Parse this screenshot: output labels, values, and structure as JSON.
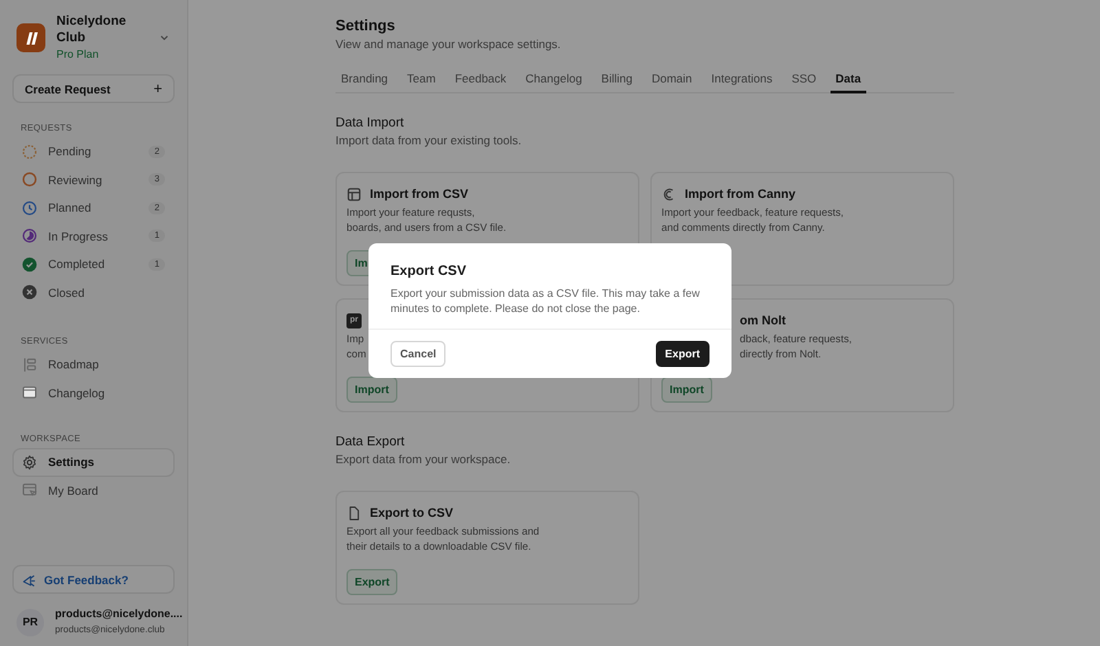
{
  "workspace": {
    "name": "Nicelydone Club",
    "plan": "Pro Plan"
  },
  "create_button": {
    "label": "Create Request",
    "icon": "+"
  },
  "sidebar": {
    "sections": [
      {
        "title": "REQUESTS",
        "items": [
          {
            "label": "Pending",
            "count": "2",
            "kind": "dashed-circle",
            "color": "#8b6136",
            "selected": false
          },
          {
            "label": "Reviewing",
            "count": "3",
            "kind": "circle",
            "color": "#894923",
            "selected": false
          },
          {
            "label": "Planned",
            "count": "2",
            "kind": "clock",
            "color": "#234a86",
            "selected": false
          },
          {
            "label": "In Progress",
            "count": "1",
            "kind": "half-circle",
            "color": "#532a79",
            "selected": false
          },
          {
            "label": "Completed",
            "count": "1",
            "kind": "check-circle",
            "color": "#13532e",
            "selected": false
          },
          {
            "label": "Closed",
            "kind": "x-circle",
            "color": "#333333",
            "selected": false
          }
        ]
      },
      {
        "title": "SERVICES",
        "items": [
          {
            "label": "Roadmap",
            "kind": "roadmap",
            "selected": false
          },
          {
            "label": "Changelog",
            "kind": "folder",
            "selected": false
          }
        ]
      },
      {
        "title": "WORKSPACE",
        "items": [
          {
            "label": "Settings",
            "kind": "gear",
            "selected": true
          },
          {
            "label": "My Board",
            "kind": "board",
            "selected": false
          }
        ]
      }
    ]
  },
  "feedback_button": "Got Feedback?",
  "user": {
    "initials": "PR",
    "name": "products@nicelydone....",
    "email": "products@nicelydone.club"
  },
  "header": {
    "title": "Settings",
    "subtitle": "View and manage your workspace settings."
  },
  "tabs": [
    {
      "label": "Branding",
      "selected": false
    },
    {
      "label": "Team",
      "selected": false
    },
    {
      "label": "Feedback",
      "selected": false
    },
    {
      "label": "Changelog",
      "selected": false
    },
    {
      "label": "Billing",
      "selected": false
    },
    {
      "label": "Domain",
      "selected": false
    },
    {
      "label": "Integrations",
      "selected": false
    },
    {
      "label": "SSO",
      "selected": false
    },
    {
      "label": "Data",
      "selected": true
    }
  ],
  "import_section": {
    "title": "Data Import",
    "subtitle": "Import data from your existing tools.",
    "cards": [
      {
        "kind": "table",
        "title": "Import from CSV",
        "lines": [
          "Import your feature requsts,",
          "boards, and users from a CSV file."
        ],
        "button": "Im"
      },
      {
        "kind": "canny",
        "title": "Import from Canny",
        "lines": [
          "Import your feedback, feature requests,",
          "and comments directly from Canny."
        ]
      },
      {
        "kind": "logo",
        "logo_text": "pr",
        "lines": [
          "Imp",
          "com"
        ],
        "button": "Import"
      },
      {
        "kind": "covered",
        "title": "om Nolt",
        "lines": [
          "dback, feature requests,",
          "directly from Nolt."
        ],
        "button": "Import"
      }
    ]
  },
  "export_section": {
    "title": "Data Export",
    "subtitle": "Export data from your workspace.",
    "cards": [
      {
        "kind": "file",
        "title": "Export to CSV",
        "lines": [
          "Export all your feedback submissions and",
          "their details to a downloadable CSV file."
        ],
        "button": "Export"
      }
    ]
  },
  "dialog": {
    "title": "Export CSV",
    "message": "Export your submission data as a CSV file. This may take a few minutes to complete. Please do not close the page.",
    "cancel": "Cancel",
    "confirm": "Export"
  }
}
